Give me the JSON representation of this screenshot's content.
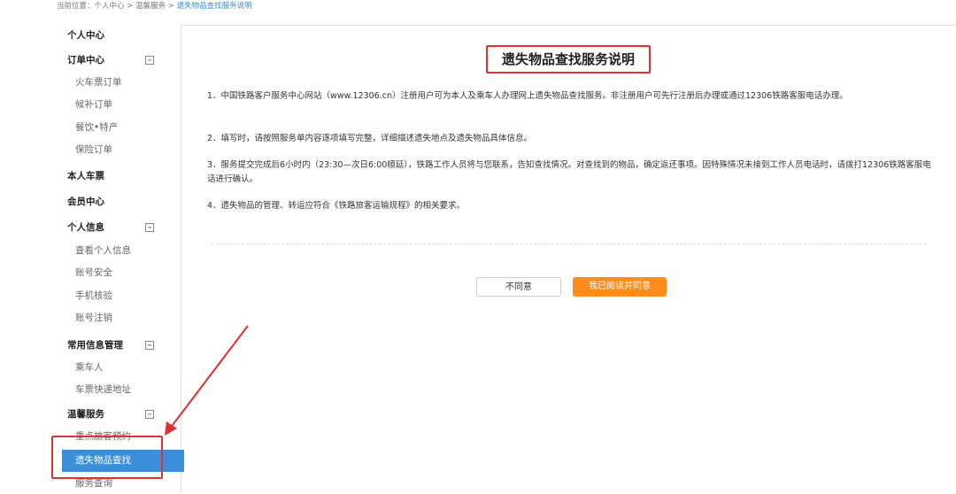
{
  "breadcrumb": {
    "prefix": "当前位置：个人中心 > 温馨服务 > ",
    "current": "遗失物品查找服务说明"
  },
  "sidebar": {
    "personal_center": "个人中心",
    "order_center": "订单中心",
    "train_orders": "火车票订单",
    "waitlist_orders": "候补订单",
    "food_orders": "餐饮•特产",
    "insurance_orders": "保险订单",
    "my_tickets": "本人车票",
    "member_center": "会员中心",
    "personal_info": "个人信息",
    "view_info": "查看个人信息",
    "account_security": "账号安全",
    "phone_verify": "手机核验",
    "account_cancel": "账号注销",
    "common_info": "常用信息管理",
    "passengers": "乘车人",
    "ticket_address": "车票快递地址",
    "warm_services": "温馨服务",
    "key_passenger": "重点旅客预约",
    "lost_items": "遗失物品查找",
    "service_query": "服务查询",
    "toggle_symbol": "−"
  },
  "main": {
    "title": "遗失物品查找服务说明",
    "paragraphs": [
      "1．中国铁路客户服务中心网站（www.12306.cn）注册用户可为本人及乘车人办理网上遗失物品查找服务。非注册用户可先行注册后办理或通过12306铁路客服电话办理。",
      "2．填写时，请按照服务单内容逐项填写完整，详细描述遗失地点及遗失物品具体信息。",
      "3．服务提交完成后6小时内（23:30—次日6:00顺延），铁路工作人员将与您联系，告知查找情况。对查找到的物品，确定返还事项。因特殊情况未接到工作人员电话时，请拨打12306铁路客服电话进行确认。",
      "4．遗失物品的管理、转运应符合《铁路旅客运输规程》的相关要求。"
    ],
    "disagree_label": "不同意",
    "agree_label": "我已阅读并同意"
  },
  "colors": {
    "accent_blue": "#3b8fd9",
    "agree_orange": "#ff8c1a",
    "annotation_red": "#e03030"
  }
}
